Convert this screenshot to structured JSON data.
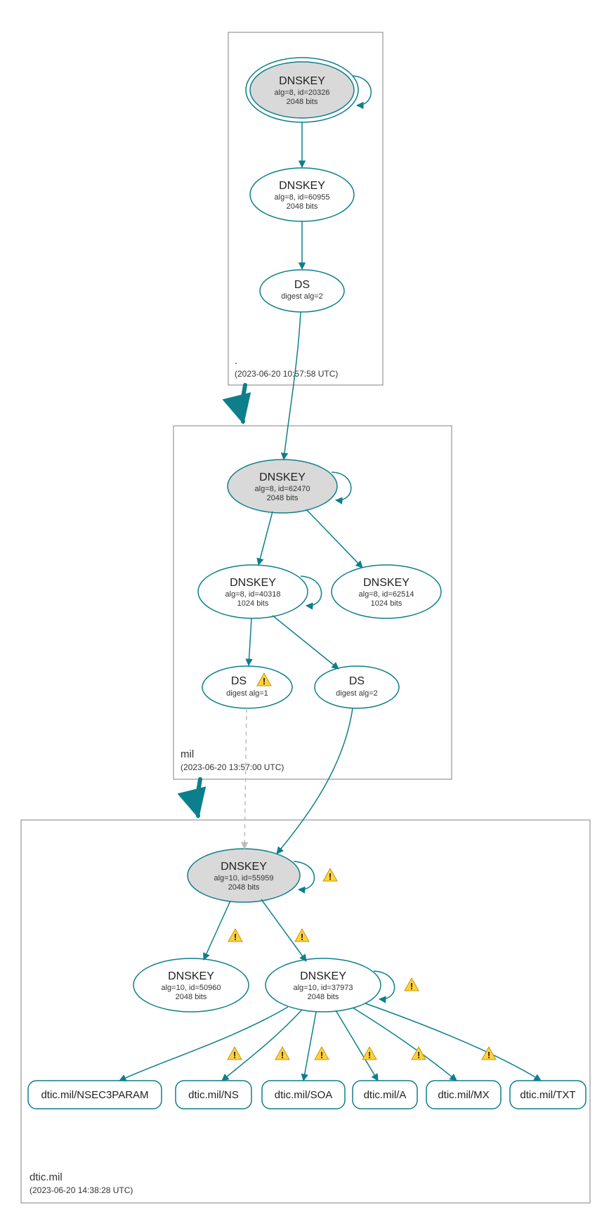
{
  "zones": {
    "root": {
      "name": ".",
      "timestamp": "(2023-06-20 10:57:58 UTC)",
      "nodes": {
        "ksk": {
          "title": "DNSKEY",
          "line2": "alg=8, id=20326",
          "line3": "2048 bits"
        },
        "zsk": {
          "title": "DNSKEY",
          "line2": "alg=8, id=60955",
          "line3": "2048 bits"
        },
        "ds": {
          "title": "DS",
          "line2": "digest alg=2"
        }
      }
    },
    "mil": {
      "name": "mil",
      "timestamp": "(2023-06-20 13:57:00 UTC)",
      "nodes": {
        "ksk": {
          "title": "DNSKEY",
          "line2": "alg=8, id=62470",
          "line3": "2048 bits"
        },
        "zsk1": {
          "title": "DNSKEY",
          "line2": "alg=8, id=40318",
          "line3": "1024 bits"
        },
        "zsk2": {
          "title": "DNSKEY",
          "line2": "alg=8, id=62514",
          "line3": "1024 bits"
        },
        "ds1": {
          "title": "DS",
          "line2": "digest alg=1"
        },
        "ds2": {
          "title": "DS",
          "line2": "digest alg=2"
        }
      }
    },
    "dtic": {
      "name": "dtic.mil",
      "timestamp": "(2023-06-20 14:38:28 UTC)",
      "nodes": {
        "ksk": {
          "title": "DNSKEY",
          "line2": "alg=10, id=55959",
          "line3": "2048 bits"
        },
        "zsk1": {
          "title": "DNSKEY",
          "line2": "alg=10, id=50960",
          "line3": "2048 bits"
        },
        "zsk2": {
          "title": "DNSKEY",
          "line2": "alg=10, id=37973",
          "line3": "2048 bits"
        }
      },
      "rrsets": [
        "dtic.mil/NSEC3PARAM",
        "dtic.mil/NS",
        "dtic.mil/SOA",
        "dtic.mil/A",
        "dtic.mil/MX",
        "dtic.mil/TXT"
      ]
    }
  }
}
